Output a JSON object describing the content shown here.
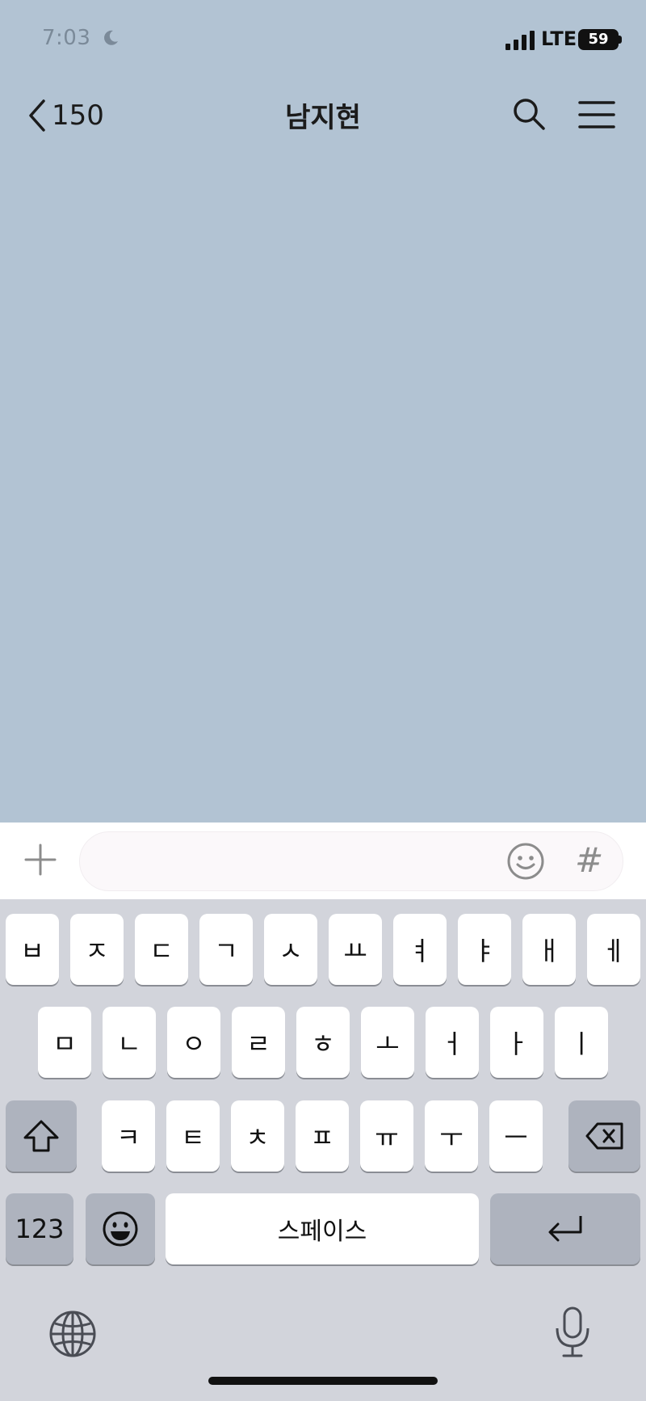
{
  "status_bar": {
    "time": "7:03",
    "network": "LTE",
    "battery": "59"
  },
  "header": {
    "back_count": "150",
    "title": "남지현"
  },
  "input": {
    "value": "",
    "placeholder": "",
    "hash_label": "#"
  },
  "keyboard": {
    "row1": [
      "ㅂ",
      "ㅈ",
      "ㄷ",
      "ㄱ",
      "ㅅ",
      "ㅛ",
      "ㅕ",
      "ㅑ",
      "ㅐ",
      "ㅔ"
    ],
    "row2": [
      "ㅁ",
      "ㄴ",
      "ㅇ",
      "ㄹ",
      "ㅎ",
      "ㅗ",
      "ㅓ",
      "ㅏ",
      "ㅣ"
    ],
    "row3": [
      "ㅋ",
      "ㅌ",
      "ㅊ",
      "ㅍ",
      "ㅠ",
      "ㅜ",
      "ㅡ"
    ],
    "numbers_label": "123",
    "space_label": "스페이스"
  },
  "colors": {
    "chat_background": "#b2c3d3",
    "keyboard_background": "#d2d4db"
  }
}
